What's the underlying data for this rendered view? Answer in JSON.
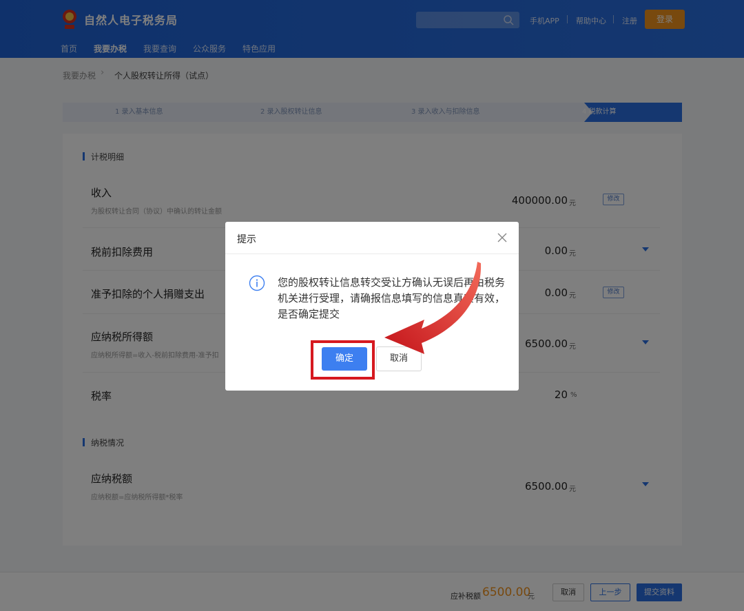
{
  "header": {
    "site_name": "自然人电子税务局",
    "links": [
      "手机APP",
      "帮助中心",
      "注册"
    ],
    "login_label": "登录",
    "nav": [
      "首页",
      "我要办税",
      "我要查询",
      "公众服务",
      "特色应用"
    ],
    "brand_color": "#1f63d6",
    "accent_color": "#f0921d"
  },
  "breadcrumb": {
    "root": "我要办税",
    "current": "个人股权转让所得（试点）"
  },
  "steps": [
    "1 录入基本信息",
    "2 录入股权转让信息",
    "3 录入收入与扣除信息",
    "4 税款计算"
  ],
  "section1": {
    "title": "计税明细",
    "rows": [
      {
        "label": "收入",
        "sub": "为股权转让合同（协议）中确认的转让金额",
        "value": "400000.00",
        "unit": "元",
        "action": "修改"
      },
      {
        "label": "税前扣除费用",
        "value": "0.00",
        "unit": "元"
      },
      {
        "label": "准予扣除的个人捐赠支出",
        "value": "0.00",
        "unit": "元",
        "action": "修改"
      },
      {
        "label": "应纳税所得额",
        "sub": "应纳税所得额=收入-税前扣除费用-准予扣",
        "value": "6500.00",
        "unit": "元"
      },
      {
        "label": "税率",
        "value": "20",
        "unit": "%"
      }
    ]
  },
  "section2": {
    "title": "纳税情况",
    "rows": [
      {
        "label": "应纳税额",
        "sub": "应纳税额=应纳税所得额*税率",
        "value": "6500.00",
        "unit": "元"
      }
    ]
  },
  "footer": {
    "due_label": "应补税额",
    "due_amount": "6500.00",
    "due_unit": "元",
    "cancel": "取消",
    "prev": "上一步",
    "submit": "提交资料"
  },
  "modal": {
    "title": "提示",
    "message": "您的股权转让信息转交受让方确认无误后再由税务机关进行受理，请确报信息填写的信息真实有效，是否确定提交",
    "ok": "确定",
    "cancel": "取消"
  },
  "icons": {
    "logo": "tax-emblem-icon",
    "search": "search-icon",
    "close": "close-icon",
    "info": "info-icon",
    "caret": "caret-down-icon"
  }
}
